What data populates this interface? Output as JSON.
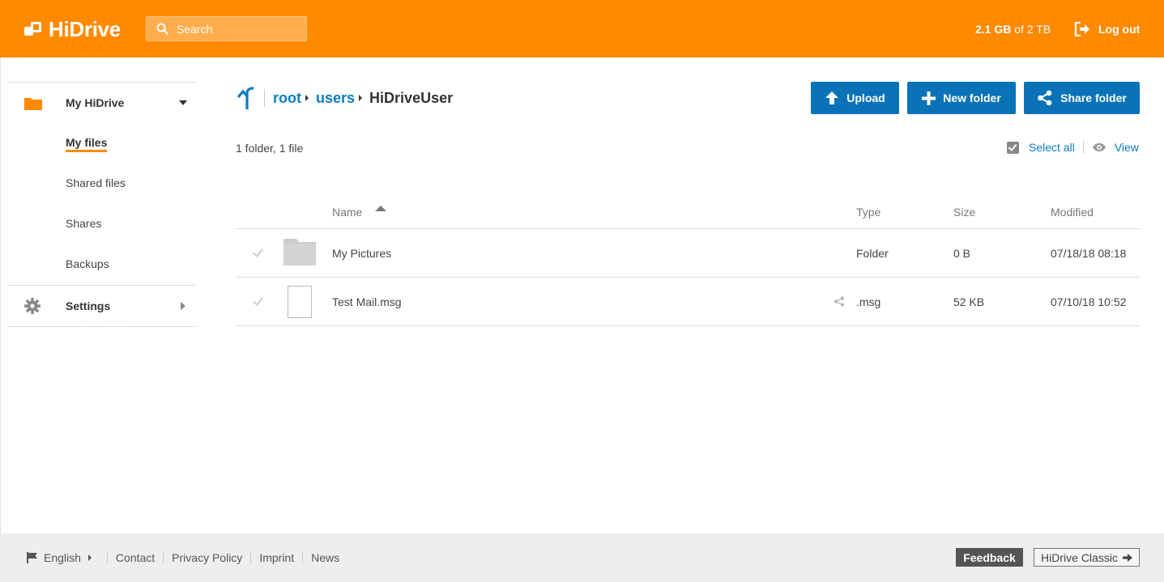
{
  "header": {
    "logo_text": "HiDrive",
    "search_placeholder": "Search",
    "quota_used": "2.1 GB",
    "quota_total": "of 2 TB",
    "logout_label": "Log out"
  },
  "sidebar": {
    "main_label": "My HiDrive",
    "items": [
      {
        "label": "My files",
        "active": true
      },
      {
        "label": "Shared files"
      },
      {
        "label": "Shares"
      },
      {
        "label": "Backups"
      }
    ],
    "settings_label": "Settings"
  },
  "breadcrumb": {
    "parts": [
      "root",
      "users"
    ],
    "current": "HiDriveUser"
  },
  "actions": {
    "upload": "Upload",
    "new_folder": "New folder",
    "share_folder": "Share folder"
  },
  "summary": "1 folder, 1 file",
  "tools": {
    "select_all": "Select all",
    "view": "View"
  },
  "table": {
    "headers": {
      "name": "Name",
      "type": "Type",
      "size": "Size",
      "modified": "Modified"
    },
    "rows": [
      {
        "name": "My Pictures",
        "type": "Folder",
        "size": "0 B",
        "modified": "07/18/18 08:18",
        "icon": "folder-icon"
      },
      {
        "name": "Test Mail.msg",
        "type": ".msg",
        "size": "52 KB",
        "modified": "07/10/18 10:52",
        "icon": "file-icon"
      }
    ]
  },
  "footer": {
    "language": "English",
    "links": [
      "Contact",
      "Privacy Policy",
      "Imprint",
      "News"
    ],
    "feedback": "Feedback",
    "classic": "HiDrive Classic"
  },
  "colors": {
    "brand": "#ff8a00",
    "primary": "#0a73b7",
    "link": "#0a7cc0"
  }
}
